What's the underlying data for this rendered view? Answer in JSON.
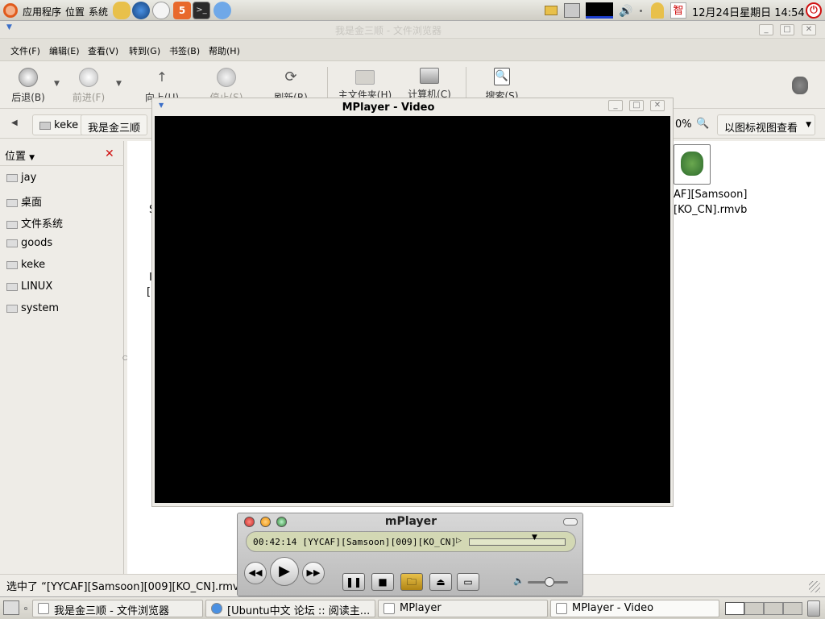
{
  "top_panel": {
    "menus": [
      "应用程序",
      "位置",
      "系统"
    ],
    "clock": "12月24日星期日 14:54",
    "ime_label": "智"
  },
  "nautilus": {
    "window_title": "我是金三顺 - 文件浏览器",
    "menu": [
      "文件(F)",
      "编辑(E)",
      "查看(V)",
      "转到(G)",
      "书签(B)",
      "帮助(H)"
    ],
    "toolbar": {
      "back": "后退(B)",
      "forward": "前进(F)",
      "up": "向上(U)",
      "stop": "停止(S)",
      "reload": "刷新(R)",
      "home": "主文件夹(H)",
      "computer": "计算机(C)",
      "search": "搜索(S)"
    },
    "breadcrumbs": [
      "keke",
      "我是金三顺"
    ],
    "zoom": "0%",
    "view_mode": "以图标视图查看",
    "sidebar": {
      "header": "位置",
      "items": [
        "jay",
        "桌面",
        "文件系统",
        "goods",
        "keke",
        "LINUX",
        "system"
      ]
    },
    "file_label_line1": "AF][Samsoon]",
    "file_label_line2": "[KO_CN].rmvb",
    "left_fragments": [
      "S",
      "I",
      "["
    ],
    "status": "选中了 “[YYCAF][Samsoon][009][KO_CN].rmvb"
  },
  "video_window": {
    "title": "MPlayer - Video"
  },
  "mplayer_skin": {
    "title": "mPlayer",
    "lcd_text": "00:42:14 [YYCAF][Samsoon][009][KO_CN]",
    "seek_fraction": 0.7,
    "volume_fraction": 0.55
  },
  "taskbar": {
    "tasks": [
      "我是金三顺 - 文件浏览器",
      "[Ubuntu中文 论坛 :: 阅读主...",
      "MPlayer",
      "MPlayer - Video"
    ]
  },
  "colors": {
    "ubuntu_orange": "#e05a1c",
    "logout_red": "#d01010",
    "lcd_green": "#d3d8b4"
  }
}
